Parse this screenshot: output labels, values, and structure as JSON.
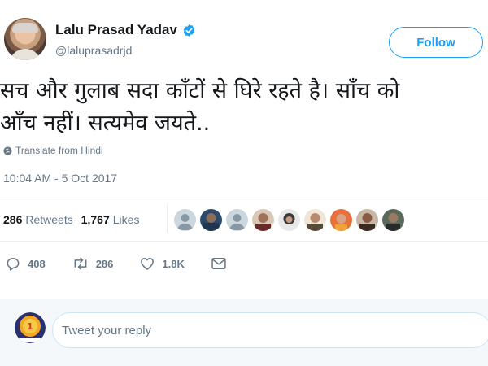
{
  "user": {
    "name": "Lalu Prasad Yadav",
    "handle": "@laluprasadrjd",
    "follow_label": "Follow"
  },
  "tweet": {
    "line1": "सच और गुलाब सदा काँटों से घिरे रहते है। साँच को",
    "line2": "आँच नहीं। सत्यमेव जयते..",
    "translate_label": "Translate from Hindi",
    "timestamp": "10:04 AM - 5 Oct 2017"
  },
  "stats": {
    "retweets_count": "286",
    "retweets_label": "Retweets",
    "likes_count": "1,767",
    "likes_label": "Likes"
  },
  "actions": {
    "reply_count": "408",
    "retweet_count": "286",
    "like_count": "1.8K"
  },
  "reply": {
    "placeholder": "Tweet your reply"
  },
  "colors": {
    "accent": "#1da1f2",
    "secondary_text": "#657786",
    "divider": "#e6ecf0"
  },
  "icons": {
    "verified": "verified-badge-icon",
    "globe": "globe-icon",
    "reply": "reply-icon",
    "retweet": "retweet-icon",
    "like": "heart-icon",
    "message": "envelope-icon"
  }
}
